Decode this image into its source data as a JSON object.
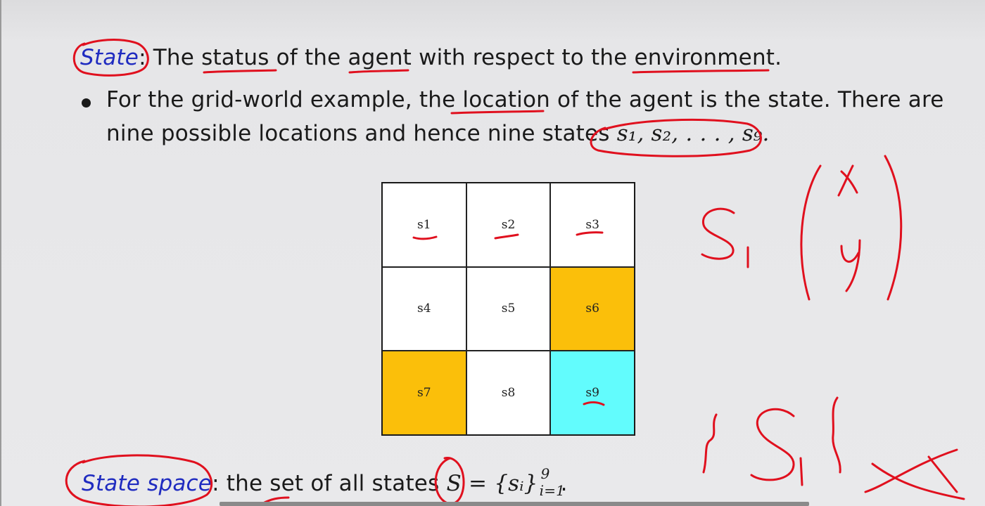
{
  "definition": {
    "term": "State",
    "colon": ":",
    "text_parts": [
      "The ",
      "status",
      " of the ",
      "agent",
      " with respect to the ",
      "environment",
      "."
    ]
  },
  "bullet": {
    "line1": "For the grid-world example, the location of the agent is the state.  There are",
    "line2_text": "nine possible locations and hence nine states ",
    "line2_math": "s₁, s₂, . . . , s₉."
  },
  "grid": {
    "cells": [
      {
        "label": "s1",
        "type": "normal"
      },
      {
        "label": "s2",
        "type": "normal"
      },
      {
        "label": "s3",
        "type": "normal"
      },
      {
        "label": "s4",
        "type": "normal"
      },
      {
        "label": "s5",
        "type": "normal"
      },
      {
        "label": "s6",
        "type": "forbidden"
      },
      {
        "label": "s7",
        "type": "forbidden"
      },
      {
        "label": "s8",
        "type": "normal"
      },
      {
        "label": "s9",
        "type": "target"
      }
    ],
    "colors": {
      "forbidden": "#fbbf0a",
      "target": "#62fcfd",
      "normal": "#ffffff"
    }
  },
  "state_space": {
    "term": "State space",
    "colon": ":",
    "text": " the set of all states ",
    "math": "S = {sᵢ}",
    "sup": "9",
    "sub": "i=1",
    "end": "."
  },
  "colors": {
    "term_blue": "#1f2bc0",
    "annotation_red": "#e0101e"
  }
}
